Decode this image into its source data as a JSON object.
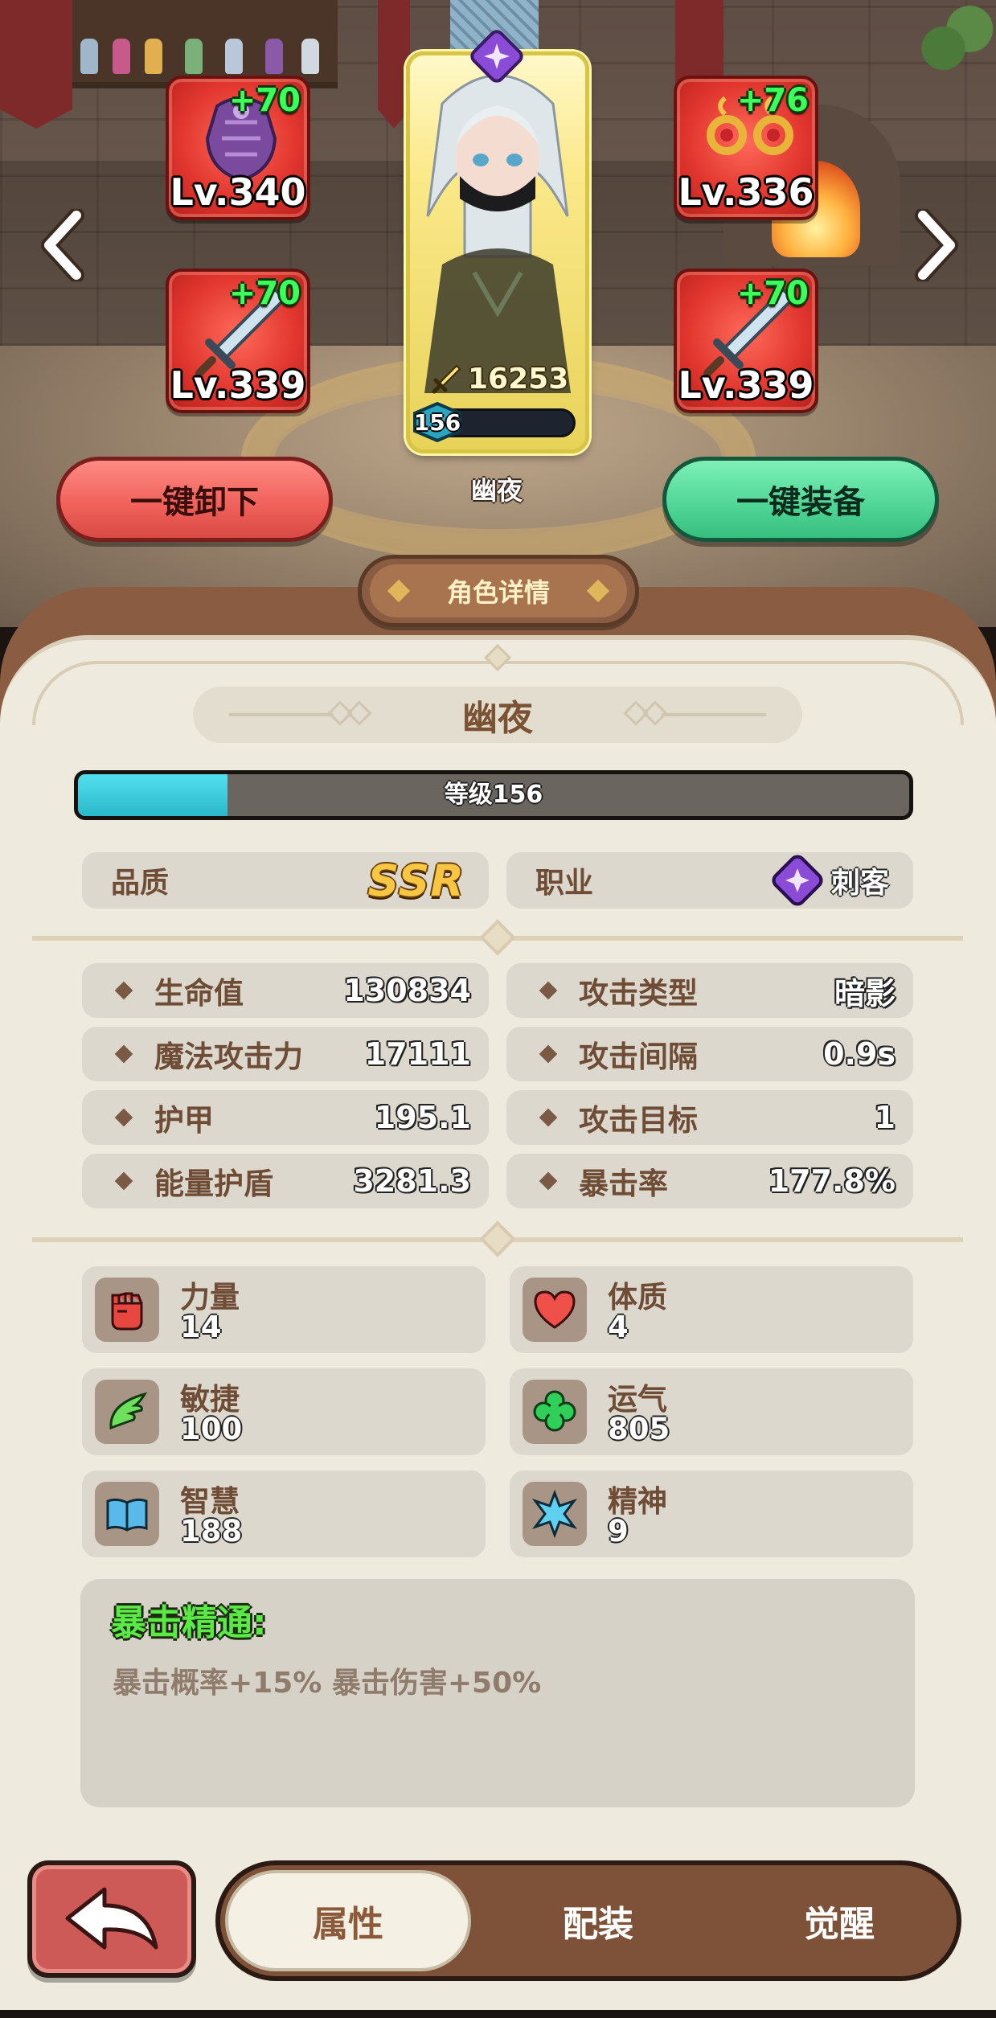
{
  "hero": {
    "name": "幽夜",
    "power": "16253",
    "level": "156",
    "level_fill_pct": 4
  },
  "slots": [
    {
      "plus": "+70",
      "level": "Lv.340",
      "item": "purple-armor-icon"
    },
    {
      "plus": "+76",
      "level": "Lv.336",
      "item": "earrings-icon"
    },
    {
      "plus": "+70",
      "level": "Lv.339",
      "item": "sword-icon"
    },
    {
      "plus": "+70",
      "level": "Lv.339",
      "item": "sword-icon"
    }
  ],
  "actions": {
    "unequip_all": "一键卸下",
    "equip_all": "一键装备"
  },
  "panel": {
    "tab_title": "角色详情",
    "name": "幽夜",
    "level_text": "等级156",
    "xp_fill_pct": 18
  },
  "info": {
    "quality_label": "品质",
    "quality_value": "SSR",
    "job_label": "职业",
    "job_value": "刺客"
  },
  "stats": [
    {
      "label": "生命值",
      "value": "130834"
    },
    {
      "label": "攻击类型",
      "value": "暗影"
    },
    {
      "label": "魔法攻击力",
      "value": "17111"
    },
    {
      "label": "攻击间隔",
      "value": "0.9s"
    },
    {
      "label": "护甲",
      "value": "195.1"
    },
    {
      "label": "攻击目标",
      "value": "1"
    },
    {
      "label": "能量护盾",
      "value": "3281.3"
    },
    {
      "label": "暴击率",
      "value": "177.8%"
    }
  ],
  "attributes": [
    {
      "label": "力量",
      "value": "14",
      "icon": "fist-icon"
    },
    {
      "label": "体质",
      "value": "4",
      "icon": "heart-icon"
    },
    {
      "label": "敏捷",
      "value": "100",
      "icon": "wing-icon"
    },
    {
      "label": "运气",
      "value": "805",
      "icon": "clover-icon"
    },
    {
      "label": "智慧",
      "value": "188",
      "icon": "book-icon"
    },
    {
      "label": "精神",
      "value": "9",
      "icon": "spirit-icon"
    }
  ],
  "skill": {
    "title": "暴击精通:",
    "desc": "暴击概率+15% 暴击伤害+50%"
  },
  "tabs": {
    "attributes": "属性",
    "gear": "配装",
    "awaken": "觉醒"
  },
  "colors": {
    "panel_bg": "#eeeade",
    "panel_border": "#8a5d42",
    "accent_green": "#5bea45",
    "xp_cyan": "#2ab8cb",
    "slot_red": "#e2372f"
  }
}
